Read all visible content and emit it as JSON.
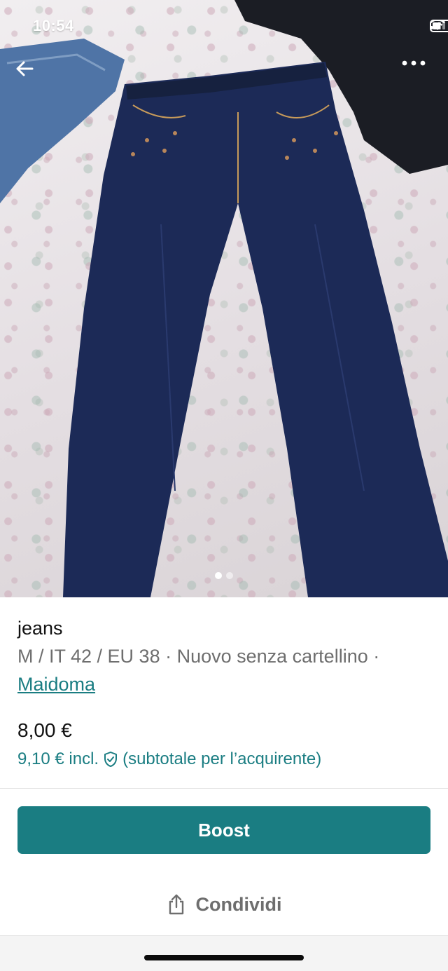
{
  "status_bar": {
    "time": "10:54"
  },
  "item": {
    "title": "jeans",
    "details": "M / IT 42 / EU 38 · Nuovo senza cartellino ·",
    "brand": "Maidoma",
    "price": "8,00 €",
    "price_incl": "9,10 € incl.",
    "price_incl_note": "(subtotale per l’acquirente)"
  },
  "gallery": {
    "image_count": 2,
    "current_index": 1
  },
  "actions": {
    "boost_label": "Boost",
    "share_label": "Condividi"
  },
  "icons": {
    "back": "arrow-left-icon",
    "more": "more-horizontal-icon",
    "buyer_protection": "shield-check-icon",
    "share": "share-icon"
  },
  "colors": {
    "accent": "#1a7d82",
    "denim": "#1c2a57"
  }
}
